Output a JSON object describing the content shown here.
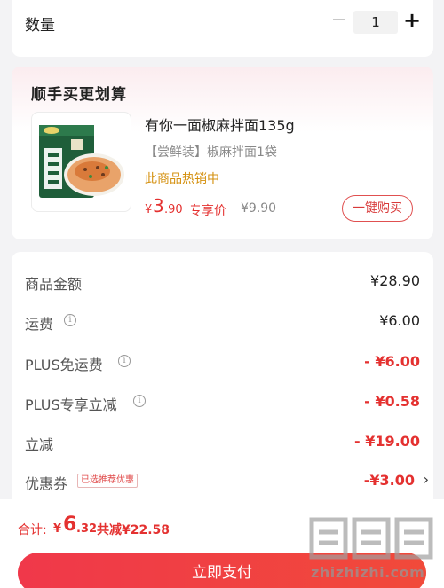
{
  "quantity": {
    "label": "数量",
    "minus": "−",
    "value": "1",
    "plus": "+"
  },
  "recommend": {
    "title": "顺手买更划算",
    "product": {
      "name": "有你一面椒麻拌面135g",
      "spec": "【尝鲜装】椒麻拌面1袋",
      "hot_tag": "此商品热销中",
      "price_symbol": "¥",
      "price_int": "3",
      "price_dec": ".90",
      "member_label": "专享价",
      "original_price": "¥9.90",
      "buy_label": "一键购买",
      "image_icon": "instant-noodle-package"
    }
  },
  "summary": {
    "rows": [
      {
        "label": "商品金额",
        "value": "¥28.90",
        "info": false
      },
      {
        "label": "运费",
        "value": "¥6.00",
        "info": true
      },
      {
        "label": "PLUS免运费",
        "value": "- ¥6.00",
        "info": true
      },
      {
        "label": "PLUS专享立减",
        "value": "- ¥0.58",
        "info": true
      },
      {
        "label": "立减",
        "value": "- ¥19.00",
        "info": false
      },
      {
        "label": "优惠券",
        "tag": "已选推荐优惠",
        "value": "-¥3.00",
        "info": false
      }
    ],
    "info_glyph": "i",
    "chevron": "›"
  },
  "footer": {
    "total_label": "合计:",
    "total_symbol": "¥",
    "total_int": "6",
    "total_dec": ".32",
    "saved": "共减¥22.58",
    "pay_label": "立即支付"
  },
  "watermark": {
    "text": "zhizhizhi.com"
  },
  "colors": {
    "accent": "#e43130",
    "hot_tag": "#d4900f",
    "background": "#f3f3f5"
  }
}
